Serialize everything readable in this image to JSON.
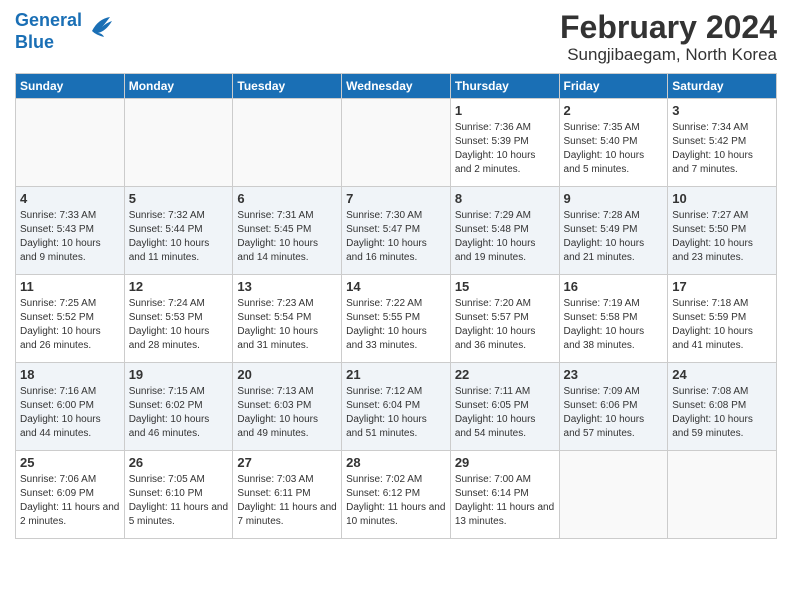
{
  "logo": {
    "line1": "General",
    "line2": "Blue"
  },
  "title": "February 2024",
  "subtitle": "Sungjibaegam, North Korea",
  "days_of_week": [
    "Sunday",
    "Monday",
    "Tuesday",
    "Wednesday",
    "Thursday",
    "Friday",
    "Saturday"
  ],
  "weeks": [
    [
      {
        "day": "",
        "sunrise": "",
        "sunset": "",
        "daylight": ""
      },
      {
        "day": "",
        "sunrise": "",
        "sunset": "",
        "daylight": ""
      },
      {
        "day": "",
        "sunrise": "",
        "sunset": "",
        "daylight": ""
      },
      {
        "day": "",
        "sunrise": "",
        "sunset": "",
        "daylight": ""
      },
      {
        "day": "1",
        "sunrise": "Sunrise: 7:36 AM",
        "sunset": "Sunset: 5:39 PM",
        "daylight": "Daylight: 10 hours and 2 minutes."
      },
      {
        "day": "2",
        "sunrise": "Sunrise: 7:35 AM",
        "sunset": "Sunset: 5:40 PM",
        "daylight": "Daylight: 10 hours and 5 minutes."
      },
      {
        "day": "3",
        "sunrise": "Sunrise: 7:34 AM",
        "sunset": "Sunset: 5:42 PM",
        "daylight": "Daylight: 10 hours and 7 minutes."
      }
    ],
    [
      {
        "day": "4",
        "sunrise": "Sunrise: 7:33 AM",
        "sunset": "Sunset: 5:43 PM",
        "daylight": "Daylight: 10 hours and 9 minutes."
      },
      {
        "day": "5",
        "sunrise": "Sunrise: 7:32 AM",
        "sunset": "Sunset: 5:44 PM",
        "daylight": "Daylight: 10 hours and 11 minutes."
      },
      {
        "day": "6",
        "sunrise": "Sunrise: 7:31 AM",
        "sunset": "Sunset: 5:45 PM",
        "daylight": "Daylight: 10 hours and 14 minutes."
      },
      {
        "day": "7",
        "sunrise": "Sunrise: 7:30 AM",
        "sunset": "Sunset: 5:47 PM",
        "daylight": "Daylight: 10 hours and 16 minutes."
      },
      {
        "day": "8",
        "sunrise": "Sunrise: 7:29 AM",
        "sunset": "Sunset: 5:48 PM",
        "daylight": "Daylight: 10 hours and 19 minutes."
      },
      {
        "day": "9",
        "sunrise": "Sunrise: 7:28 AM",
        "sunset": "Sunset: 5:49 PM",
        "daylight": "Daylight: 10 hours and 21 minutes."
      },
      {
        "day": "10",
        "sunrise": "Sunrise: 7:27 AM",
        "sunset": "Sunset: 5:50 PM",
        "daylight": "Daylight: 10 hours and 23 minutes."
      }
    ],
    [
      {
        "day": "11",
        "sunrise": "Sunrise: 7:25 AM",
        "sunset": "Sunset: 5:52 PM",
        "daylight": "Daylight: 10 hours and 26 minutes."
      },
      {
        "day": "12",
        "sunrise": "Sunrise: 7:24 AM",
        "sunset": "Sunset: 5:53 PM",
        "daylight": "Daylight: 10 hours and 28 minutes."
      },
      {
        "day": "13",
        "sunrise": "Sunrise: 7:23 AM",
        "sunset": "Sunset: 5:54 PM",
        "daylight": "Daylight: 10 hours and 31 minutes."
      },
      {
        "day": "14",
        "sunrise": "Sunrise: 7:22 AM",
        "sunset": "Sunset: 5:55 PM",
        "daylight": "Daylight: 10 hours and 33 minutes."
      },
      {
        "day": "15",
        "sunrise": "Sunrise: 7:20 AM",
        "sunset": "Sunset: 5:57 PM",
        "daylight": "Daylight: 10 hours and 36 minutes."
      },
      {
        "day": "16",
        "sunrise": "Sunrise: 7:19 AM",
        "sunset": "Sunset: 5:58 PM",
        "daylight": "Daylight: 10 hours and 38 minutes."
      },
      {
        "day": "17",
        "sunrise": "Sunrise: 7:18 AM",
        "sunset": "Sunset: 5:59 PM",
        "daylight": "Daylight: 10 hours and 41 minutes."
      }
    ],
    [
      {
        "day": "18",
        "sunrise": "Sunrise: 7:16 AM",
        "sunset": "Sunset: 6:00 PM",
        "daylight": "Daylight: 10 hours and 44 minutes."
      },
      {
        "day": "19",
        "sunrise": "Sunrise: 7:15 AM",
        "sunset": "Sunset: 6:02 PM",
        "daylight": "Daylight: 10 hours and 46 minutes."
      },
      {
        "day": "20",
        "sunrise": "Sunrise: 7:13 AM",
        "sunset": "Sunset: 6:03 PM",
        "daylight": "Daylight: 10 hours and 49 minutes."
      },
      {
        "day": "21",
        "sunrise": "Sunrise: 7:12 AM",
        "sunset": "Sunset: 6:04 PM",
        "daylight": "Daylight: 10 hours and 51 minutes."
      },
      {
        "day": "22",
        "sunrise": "Sunrise: 7:11 AM",
        "sunset": "Sunset: 6:05 PM",
        "daylight": "Daylight: 10 hours and 54 minutes."
      },
      {
        "day": "23",
        "sunrise": "Sunrise: 7:09 AM",
        "sunset": "Sunset: 6:06 PM",
        "daylight": "Daylight: 10 hours and 57 minutes."
      },
      {
        "day": "24",
        "sunrise": "Sunrise: 7:08 AM",
        "sunset": "Sunset: 6:08 PM",
        "daylight": "Daylight: 10 hours and 59 minutes."
      }
    ],
    [
      {
        "day": "25",
        "sunrise": "Sunrise: 7:06 AM",
        "sunset": "Sunset: 6:09 PM",
        "daylight": "Daylight: 11 hours and 2 minutes."
      },
      {
        "day": "26",
        "sunrise": "Sunrise: 7:05 AM",
        "sunset": "Sunset: 6:10 PM",
        "daylight": "Daylight: 11 hours and 5 minutes."
      },
      {
        "day": "27",
        "sunrise": "Sunrise: 7:03 AM",
        "sunset": "Sunset: 6:11 PM",
        "daylight": "Daylight: 11 hours and 7 minutes."
      },
      {
        "day": "28",
        "sunrise": "Sunrise: 7:02 AM",
        "sunset": "Sunset: 6:12 PM",
        "daylight": "Daylight: 11 hours and 10 minutes."
      },
      {
        "day": "29",
        "sunrise": "Sunrise: 7:00 AM",
        "sunset": "Sunset: 6:14 PM",
        "daylight": "Daylight: 11 hours and 13 minutes."
      },
      {
        "day": "",
        "sunrise": "",
        "sunset": "",
        "daylight": ""
      },
      {
        "day": "",
        "sunrise": "",
        "sunset": "",
        "daylight": ""
      }
    ]
  ]
}
